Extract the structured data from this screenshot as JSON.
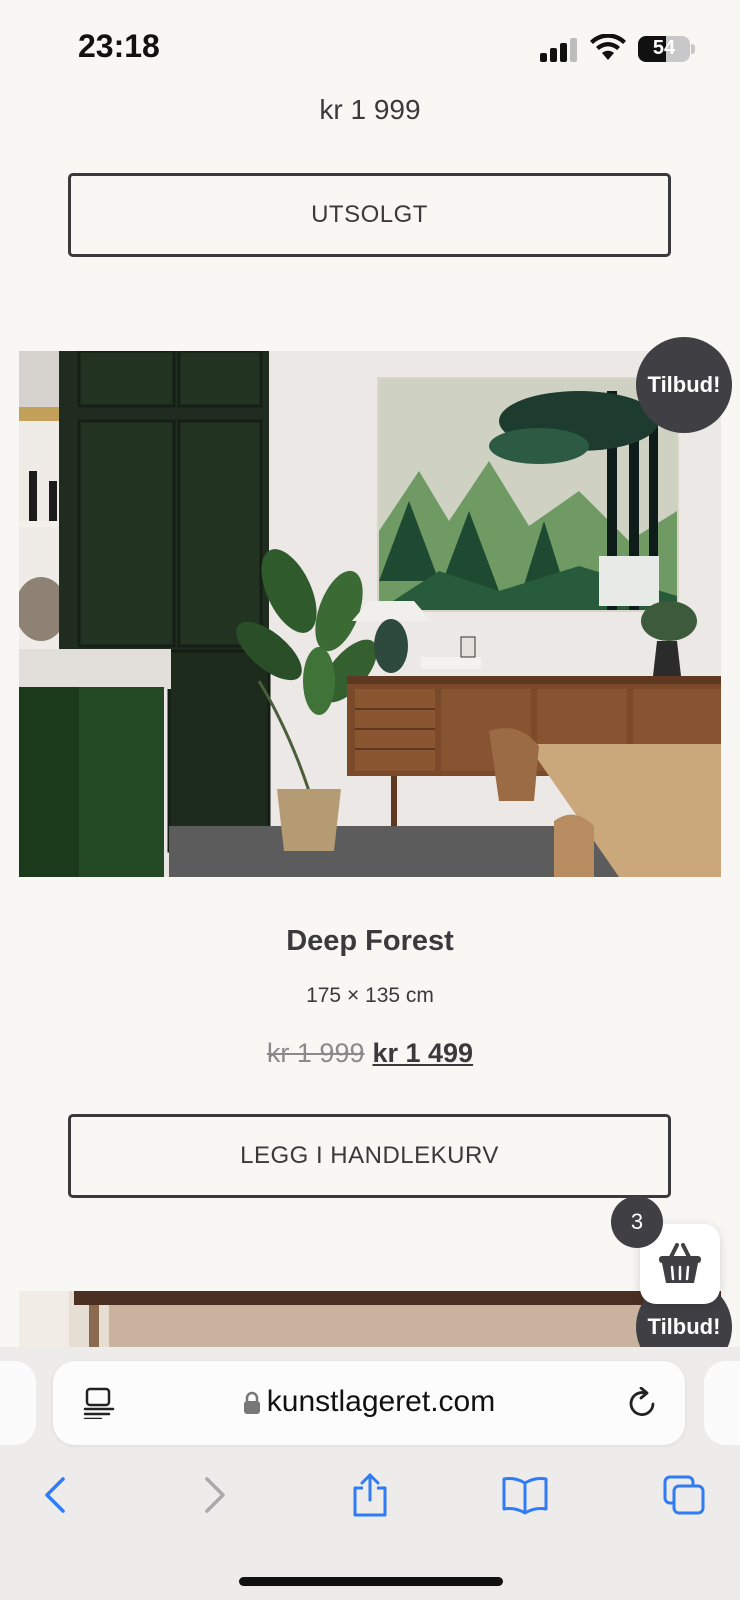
{
  "status_bar": {
    "time": "23:18",
    "battery_percent": "54",
    "battery_level": 0.54,
    "icons": [
      "cellular-signal-icon",
      "wifi-icon",
      "battery-icon"
    ]
  },
  "previous_product": {
    "price": "kr 1 999",
    "button_label": "UTSOLGT"
  },
  "product": {
    "badge": "Tilbud!",
    "title": "Deep Forest",
    "size": "175 × 135 cm",
    "price_old": "kr 1 999",
    "price_new": "kr 1 499",
    "add_to_cart_label": "LEGG I HANDLEKURV"
  },
  "next_product": {
    "badge": "Tilbud!"
  },
  "cart": {
    "count": "3",
    "icon": "shopping-basket-icon"
  },
  "browser": {
    "url": "kunstlageret.com",
    "icons": [
      "reader-mode-icon",
      "lock-icon",
      "reload-icon",
      "back-icon",
      "forward-icon",
      "share-icon",
      "bookmarks-icon",
      "tabs-icon"
    ]
  },
  "colors": {
    "page_bg": "#f9f7f4",
    "text": "#3a3a3c",
    "badge_bg": "#3f3f44",
    "safari_blue": "#2f7cf6"
  }
}
